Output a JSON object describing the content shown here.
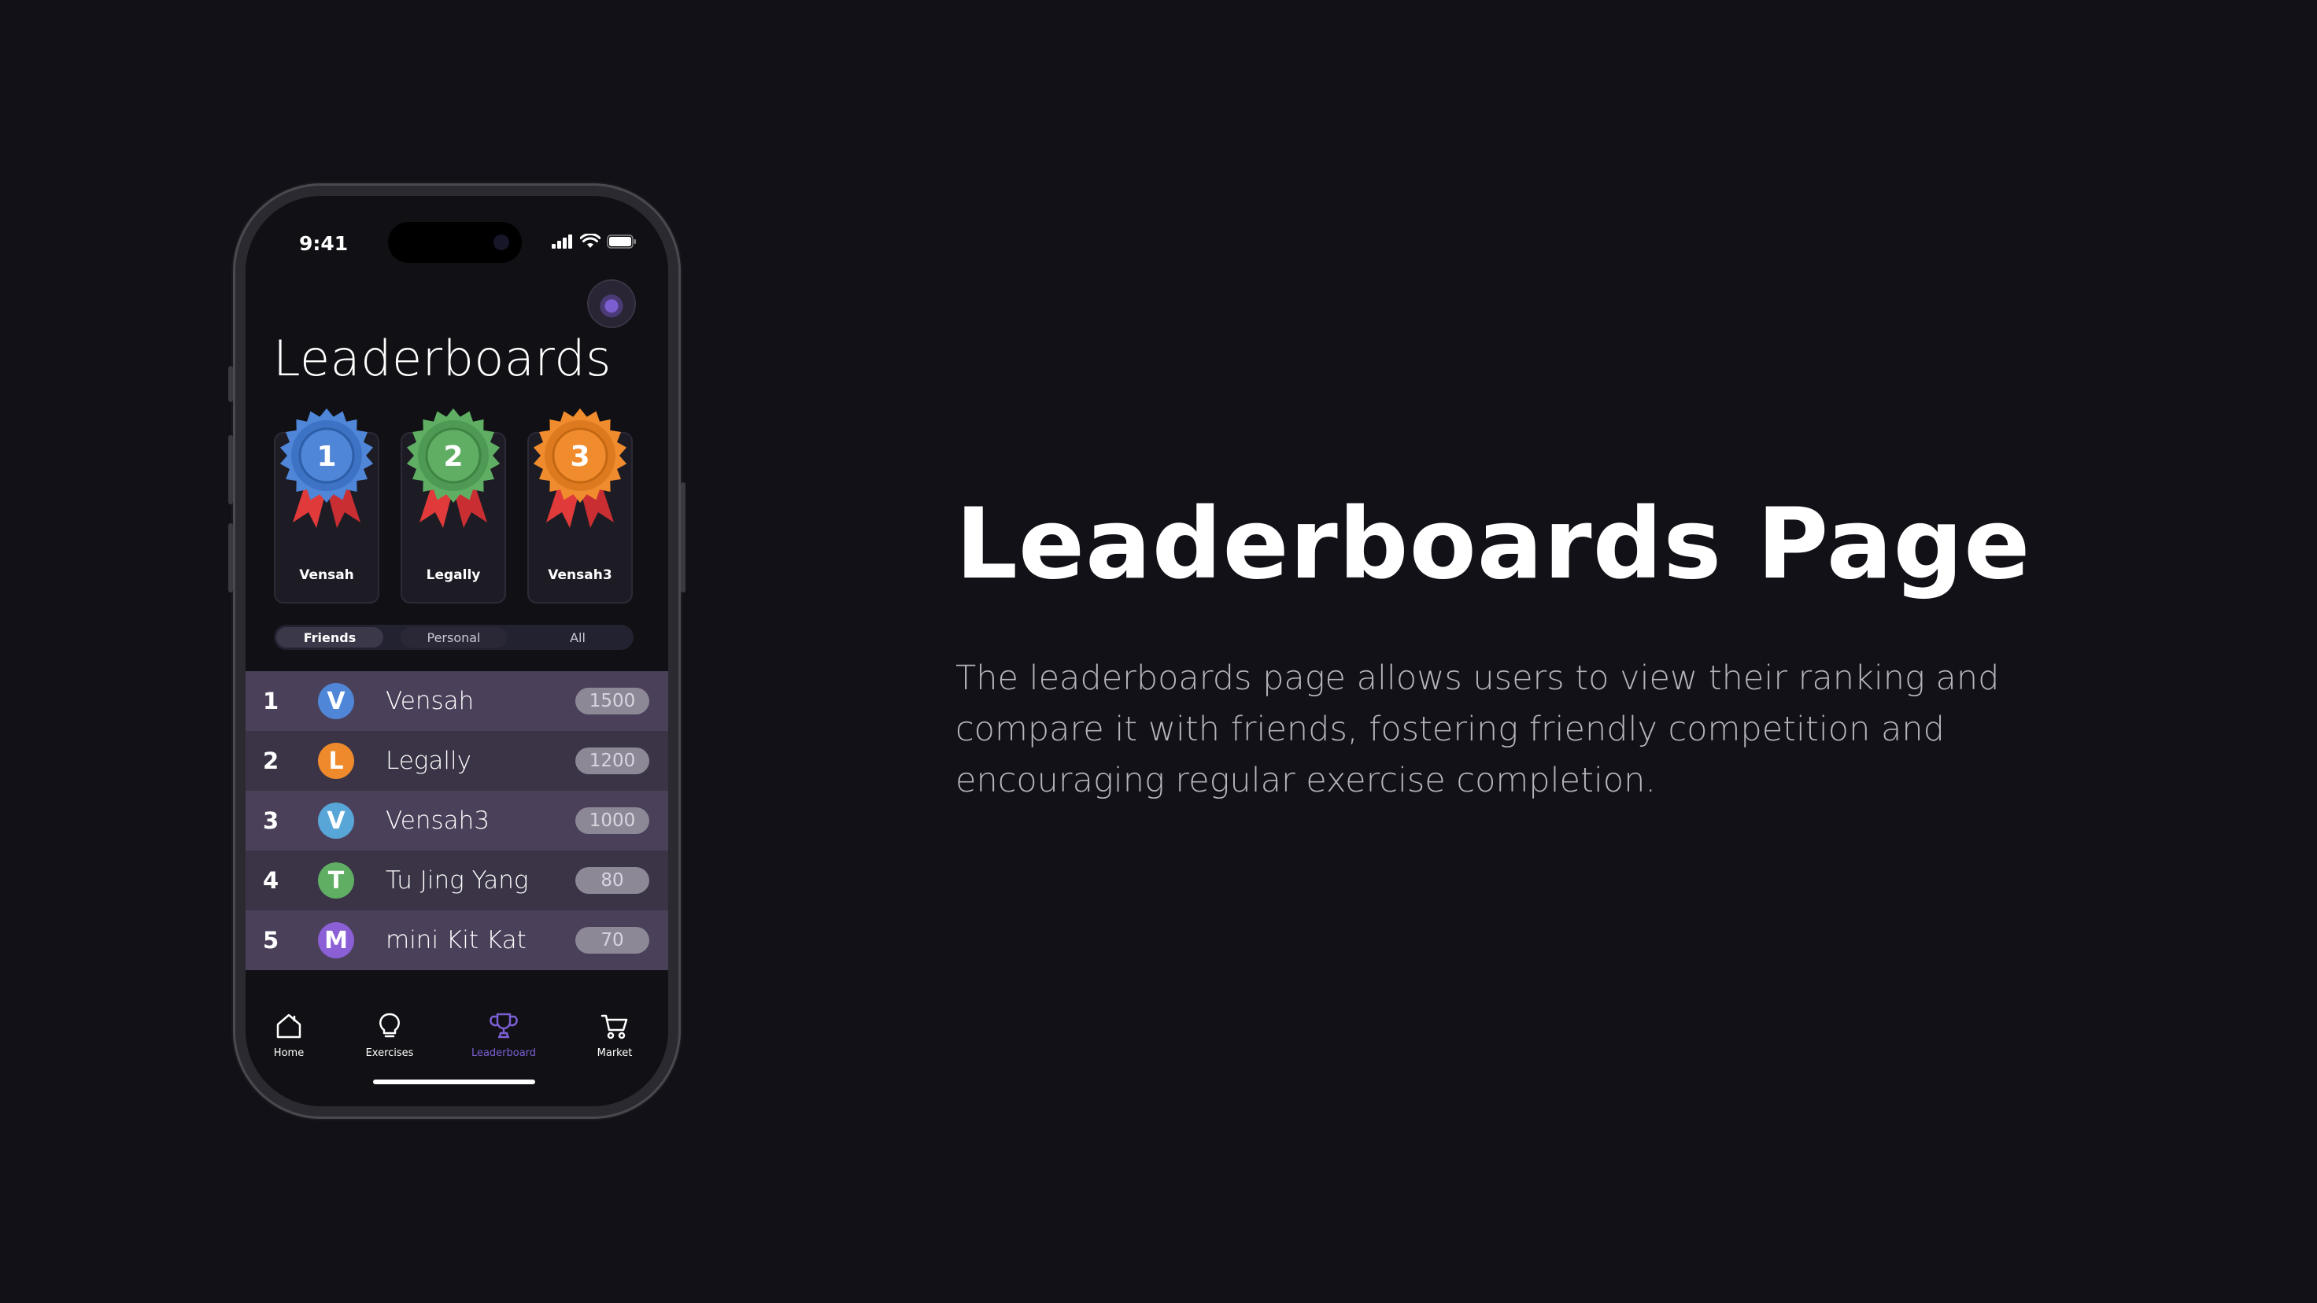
{
  "status_bar": {
    "time": "9:41"
  },
  "page": {
    "title": "Leaderboards"
  },
  "podium": [
    {
      "rank": "1",
      "name": "Vensah",
      "color": "#4f86d8"
    },
    {
      "rank": "2",
      "name": "Legally",
      "color": "#5fae63"
    },
    {
      "rank": "3",
      "name": "Vensah3",
      "color": "#f08c2e"
    }
  ],
  "tabs": [
    {
      "label": "Friends",
      "active": true
    },
    {
      "label": "Personal",
      "active": false
    },
    {
      "label": "All",
      "active": false
    }
  ],
  "leaderboard": [
    {
      "rank": "1",
      "initial": "V",
      "name": "Vensah",
      "score": "1500",
      "color": "#4f86d8"
    },
    {
      "rank": "2",
      "initial": "L",
      "name": "Legally",
      "score": "1200",
      "color": "#ee8a2b"
    },
    {
      "rank": "3",
      "initial": "V",
      "name": "Vensah3",
      "score": "1000",
      "color": "#58a5d8"
    },
    {
      "rank": "4",
      "initial": "T",
      "name": "Tu Jing Yang",
      "score": "80",
      "color": "#5fae63"
    },
    {
      "rank": "5",
      "initial": "M",
      "name": "mini Kit Kat",
      "score": "70",
      "color": "#8b5fd6"
    }
  ],
  "nav": [
    {
      "label": "Home",
      "icon": "home-icon"
    },
    {
      "label": "Exercises",
      "icon": "lightbulb-icon"
    },
    {
      "label": "Leaderboard",
      "icon": "trophy-icon",
      "active": true
    },
    {
      "label": "Market",
      "icon": "cart-icon"
    }
  ],
  "hero": {
    "headline": "Leaderboards Page",
    "description": "The leaderboards page allows users to view their ranking and compare it with friends, fostering friendly competition and encouraging regular exercise completion."
  },
  "colors": {
    "background": "#121117",
    "accent": "#7c5fd4"
  }
}
